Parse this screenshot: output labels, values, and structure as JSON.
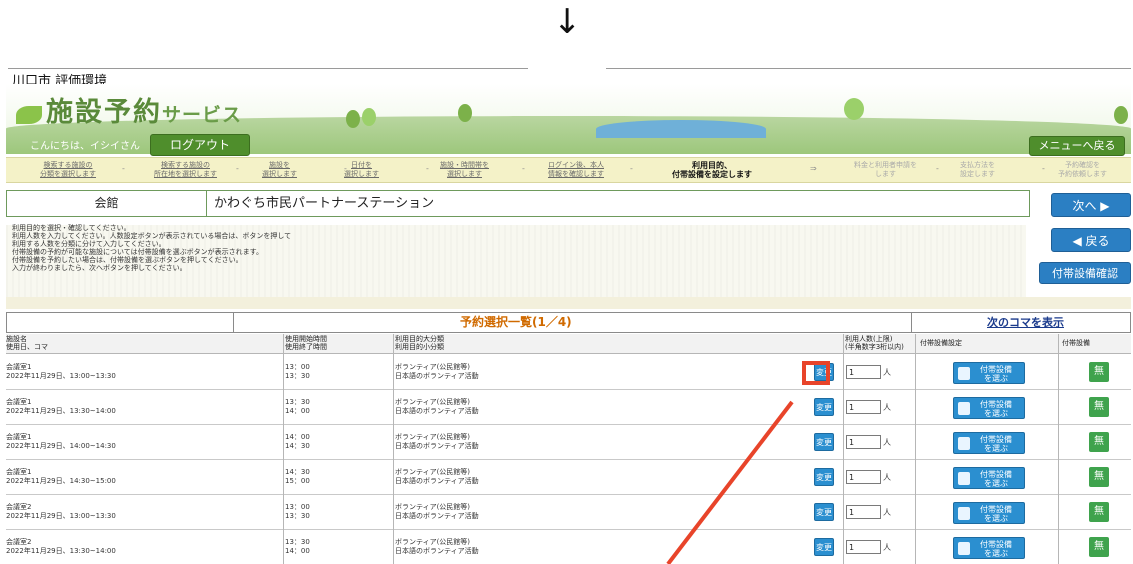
{
  "overlay": {
    "down_arrow": "↓"
  },
  "env_label": "川口市 評価環境",
  "banner": {
    "logo_main": "施設予約",
    "logo_sub": "サービス"
  },
  "header": {
    "greeting": "こんにちは、イシイさん",
    "logout_label": "ログアウト",
    "menu_label": "メニューへ戻る"
  },
  "steps": [
    {
      "label": "検索する施設の\n分類を選択します",
      "state": "done"
    },
    {
      "label": "検索する施設の\n所在地を選択します",
      "state": "done"
    },
    {
      "label": "施設を\n選択します",
      "state": "done"
    },
    {
      "label": "日付を\n選択します",
      "state": "done"
    },
    {
      "label": "施設・時間帯を\n選択します",
      "state": "done"
    },
    {
      "label": "ログイン後、本人\n情報を確認します",
      "state": "done"
    },
    {
      "label": "利用目的、\n付帯設備を設定します",
      "state": "current"
    },
    {
      "label": "料金と利用者申請を\nします",
      "state": "pending"
    },
    {
      "label": "支払方法を\n設定します",
      "state": "pending"
    },
    {
      "label": "予約確認を\n予約依頼します",
      "state": "pending"
    }
  ],
  "step_arrow": "⇒",
  "facility": {
    "label": "会館",
    "value": "かわぐち市民パートナーステーション"
  },
  "side_buttons": {
    "next": "次へ",
    "back": "戻る",
    "equip_confirm": "付帯設備確認"
  },
  "instructions": [
    "利用目的を選択・確認してください。",
    "利用人数を入力してください。人数設定ボタンが表示されている場合は、ボタンを押して",
    "利用する人数を分類に分けて入力してください。",
    "付帯設備の予約が可能な施設については付帯設備を選ぶボタンが表示されます。",
    "付帯設備を予約したい場合は、付帯設備を選ぶボタンを押してください。",
    "入力が終わりましたら、次へボタンを押してください。"
  ],
  "list": {
    "title": "予約選択一覧(1／4)",
    "next_link": "次のコマを表示"
  },
  "columns": {
    "facility": [
      "施設名",
      "使用日、コマ"
    ],
    "time": [
      "使用開始時間",
      "使用終了時間"
    ],
    "purpose": [
      "利用目的大分類",
      "利用目的小分類"
    ],
    "count": [
      "利用人数(上限)",
      "(半角数字3桁以内)"
    ],
    "equip_setting": "付帯設備設定",
    "equip": "付帯設備"
  },
  "rows": [
    {
      "name": "会議室1",
      "date": "2022年11月29日、13:00~13:30",
      "start": "13：00",
      "end": "13：30",
      "purpose_major": "ボランティア(公民館等)",
      "purpose_minor": "日本語のボランティア活動",
      "change": "変更",
      "count": "1",
      "unit": "人",
      "equip_btn": "付帯設備\nを選ぶ",
      "equip": "無"
    },
    {
      "name": "会議室1",
      "date": "2022年11月29日、13:30~14:00",
      "start": "13：30",
      "end": "14：00",
      "purpose_major": "ボランティア(公民館等)",
      "purpose_minor": "日本語のボランティア活動",
      "change": "変更",
      "count": "1",
      "unit": "人",
      "equip_btn": "付帯設備\nを選ぶ",
      "equip": "無"
    },
    {
      "name": "会議室1",
      "date": "2022年11月29日、14:00~14:30",
      "start": "14：00",
      "end": "14：30",
      "purpose_major": "ボランティア(公民館等)",
      "purpose_minor": "日本語のボランティア活動",
      "change": "変更",
      "count": "1",
      "unit": "人",
      "equip_btn": "付帯設備\nを選ぶ",
      "equip": "無"
    },
    {
      "name": "会議室1",
      "date": "2022年11月29日、14:30~15:00",
      "start": "14：30",
      "end": "15：00",
      "purpose_major": "ボランティア(公民館等)",
      "purpose_minor": "日本語のボランティア活動",
      "change": "変更",
      "count": "1",
      "unit": "人",
      "equip_btn": "付帯設備\nを選ぶ",
      "equip": "無"
    },
    {
      "name": "会議室2",
      "date": "2022年11月29日、13:00~13:30",
      "start": "13：00",
      "end": "13：30",
      "purpose_major": "ボランティア(公民館等)",
      "purpose_minor": "日本語のボランティア活動",
      "change": "変更",
      "count": "1",
      "unit": "人",
      "equip_btn": "付帯設備\nを選ぶ",
      "equip": "無"
    },
    {
      "name": "会議室2",
      "date": "2022年11月29日、13:30~14:00",
      "start": "13：30",
      "end": "14：00",
      "purpose_major": "ボランティア(公民館等)",
      "purpose_minor": "日本語のボランティア活動",
      "change": "変更",
      "count": "1",
      "unit": "人",
      "equip_btn": "付帯設備\nを選ぶ",
      "equip": "無"
    }
  ],
  "colors": {
    "accent_blue": "#2b8fd0",
    "brand_green": "#4f8e2c",
    "highlight_red": "#e8442a",
    "title_orange": "#d06a00"
  }
}
